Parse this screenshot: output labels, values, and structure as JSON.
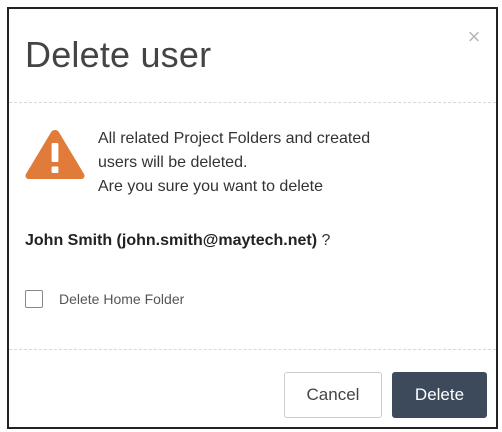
{
  "dialog": {
    "title": "Delete user",
    "close_glyph": "×",
    "warning": {
      "icon": "warning-triangle-icon",
      "color": "#e07b39",
      "lines": [
        "All related Project Folders and created",
        "users will be deleted.",
        "Are you sure you want to delete"
      ]
    },
    "user": {
      "name": "John Smith (john.smith@maytech.net)",
      "suffix": " ?"
    },
    "delete_home_folder": {
      "label": "Delete Home Folder",
      "checked": false
    },
    "buttons": {
      "cancel": "Cancel",
      "delete": "Delete"
    },
    "colors": {
      "primary_button": "#3c4a5c",
      "warning": "#e07b39"
    }
  }
}
